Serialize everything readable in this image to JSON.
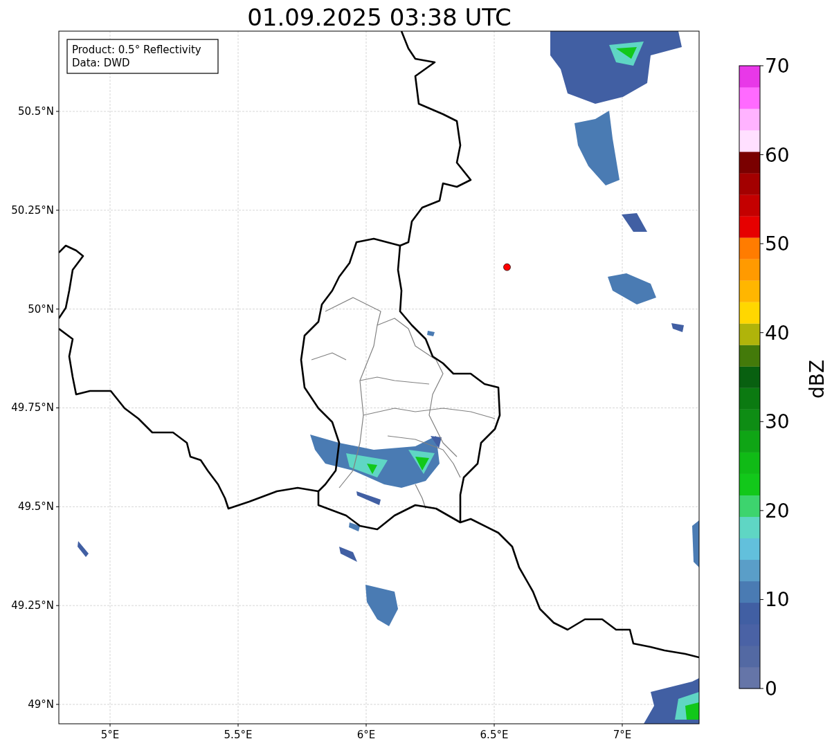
{
  "title": "01.09.2025 03:38 UTC",
  "info_box": [
    "Product: 0.5° Reflectivity",
    "Data: DWD"
  ],
  "map": {
    "x_ticks": [
      "5°E",
      "5.5°E",
      "6°E",
      "6.5°E",
      "7°E"
    ],
    "y_ticks": [
      "50.5°N",
      "50.25°N",
      "50°N",
      "49.75°N",
      "49.5°N",
      "49.25°N",
      "49°N"
    ]
  },
  "colorbar": {
    "label": "dBZ",
    "ticks": [
      "70",
      "60",
      "50",
      "40",
      "30",
      "20",
      "10",
      "0"
    ]
  }
}
